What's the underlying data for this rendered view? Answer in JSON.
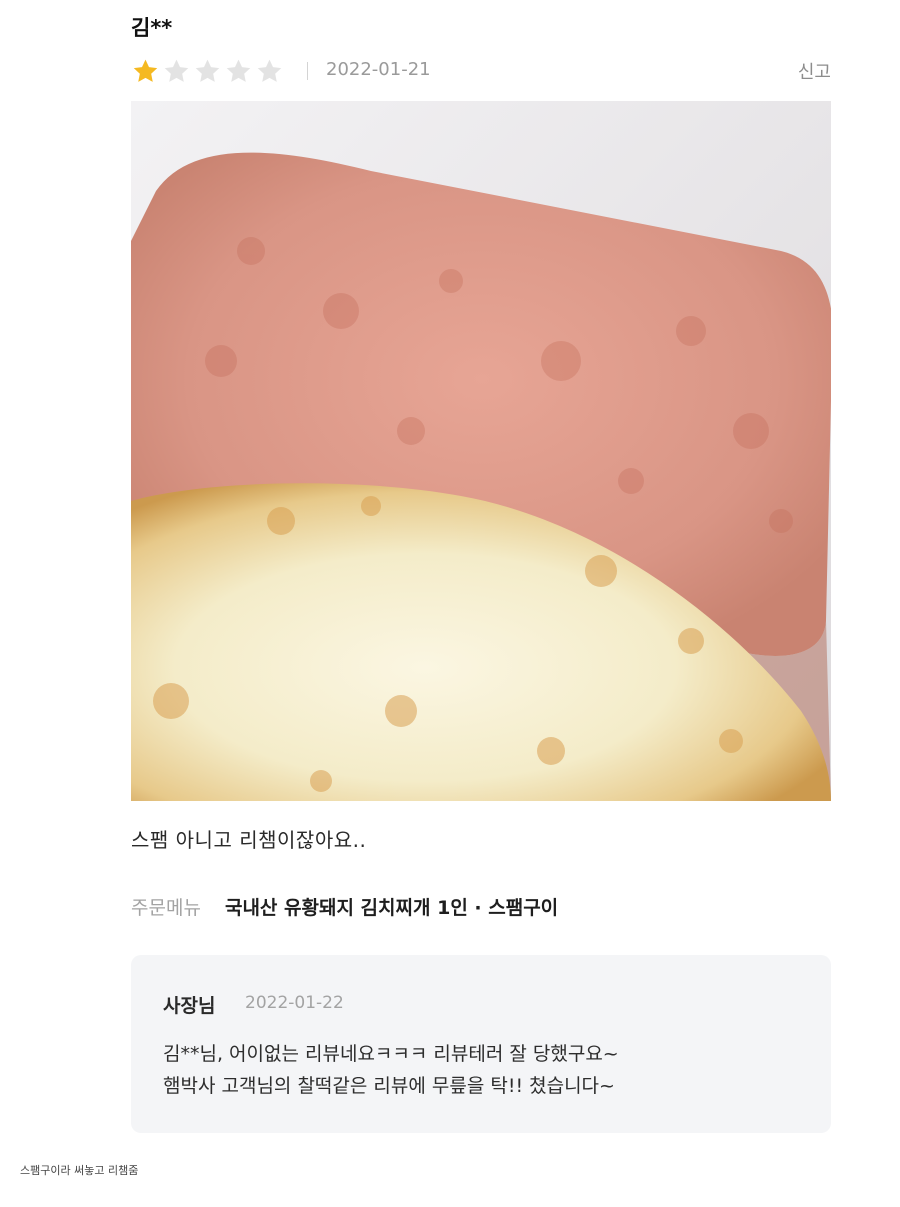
{
  "review": {
    "reviewer_name": "김**",
    "rating": 1,
    "max_rating": 5,
    "star_filled_color": "#f5b921",
    "star_empty_color": "#e3e3e3",
    "date": "2022-01-21",
    "report_label": "신고",
    "photo_icon": "photo-of-spam-slice-and-fried-egg",
    "text": "스팸 아니고 리챔이잖아요..",
    "order_label": "주문메뉴",
    "order_items": "국내산 유황돼지 김치찌개 1인 · 스팸구이"
  },
  "owner_reply": {
    "author": "사장님",
    "date": "2022-01-22",
    "lines": [
      "김**님, 어이없는 리뷰네요ㅋㅋㅋ 리뷰테러 잘 당했구요~",
      "햄박사 고객님의 찰떡같은 리뷰에 무릎을 탁!! 쳤습니다~"
    ]
  },
  "caption": "스팸구이라 써놓고 리챔줌"
}
